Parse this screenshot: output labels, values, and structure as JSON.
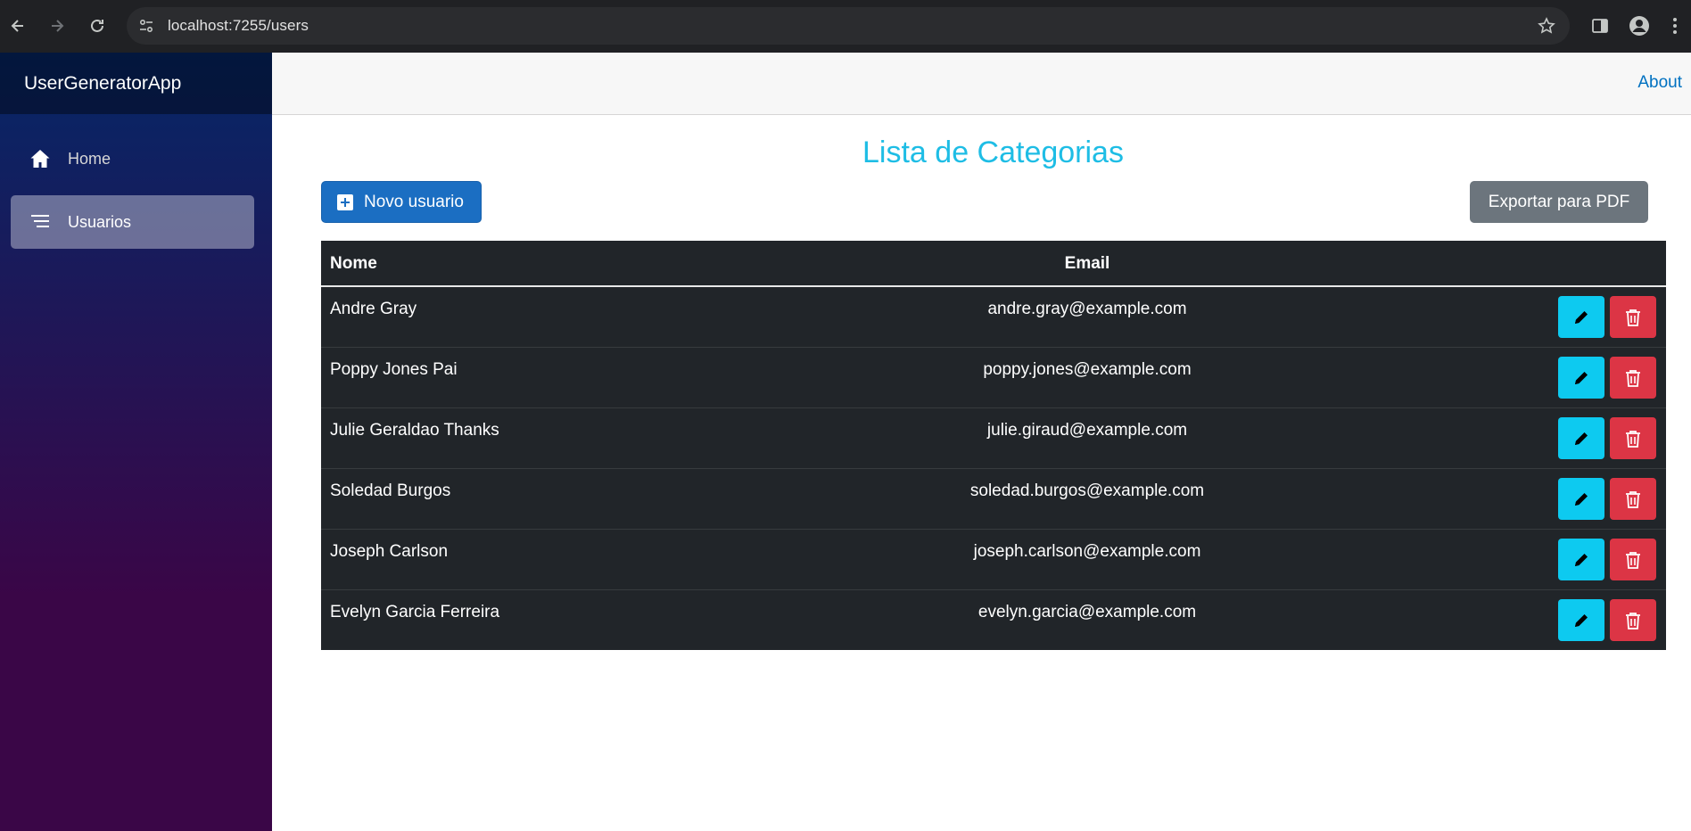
{
  "browser": {
    "url": "localhost:7255/users"
  },
  "sidebar": {
    "brand": "UserGeneratorApp",
    "items": [
      {
        "label": "Home",
        "icon": "home-icon"
      },
      {
        "label": "Usuarios",
        "icon": "list-icon",
        "active": true
      }
    ]
  },
  "top_row": {
    "about_label": "About"
  },
  "main": {
    "title": "Lista de Categorias",
    "new_button_label": "Novo usuario",
    "export_button_label": "Exportar para PDF",
    "table": {
      "columns": [
        "Nome",
        "Email"
      ],
      "rows": [
        {
          "name": "Andre Gray",
          "email": "andre.gray@example.com"
        },
        {
          "name": "Poppy Jones Pai",
          "email": "poppy.jones@example.com"
        },
        {
          "name": "Julie Geraldao Thanks",
          "email": "julie.giraud@example.com"
        },
        {
          "name": "Soledad Burgos",
          "email": "soledad.burgos@example.com"
        },
        {
          "name": "Joseph Carlson",
          "email": "joseph.carlson@example.com"
        },
        {
          "name": "Evelyn Garcia Ferreira",
          "email": "evelyn.garcia@example.com"
        }
      ]
    }
  },
  "colors": {
    "title": "#1ebde5",
    "primary": "#1b6ec2",
    "secondary": "#6c757d",
    "info": "#0dcaf0",
    "danger": "#dc3545",
    "table_dark": "#212529"
  }
}
